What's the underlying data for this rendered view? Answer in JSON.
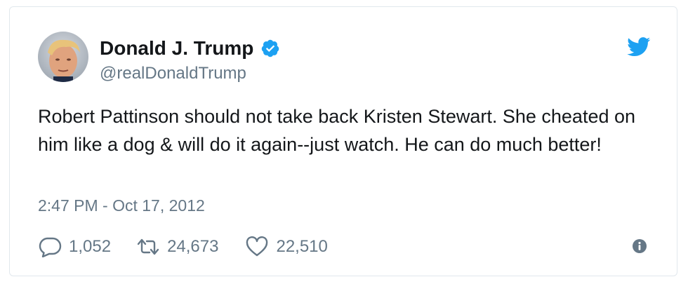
{
  "author": {
    "name": "Donald J. Trump",
    "handle": "@realDonaldTrump",
    "verified": true,
    "avatar_icon": "profile-photo"
  },
  "tweet": {
    "text": "Robert Pattinson should not take back Kristen Stewart. She cheated on him like a dog & will do it again--just watch. He can do much better!",
    "timestamp": "2:47 PM - Oct 17, 2012"
  },
  "actions": {
    "replies": "1,052",
    "retweets": "24,673",
    "likes": "22,510"
  },
  "icons": {
    "platform": "twitter-bird-icon",
    "verified": "verified-badge-icon",
    "reply": "reply-bubble-icon",
    "retweet": "retweet-icon",
    "like": "heart-icon",
    "info": "info-icon"
  },
  "colors": {
    "brand_blue": "#1da1f2",
    "text_primary": "#14171a",
    "text_secondary": "#657786",
    "border": "#e1e8ed"
  }
}
